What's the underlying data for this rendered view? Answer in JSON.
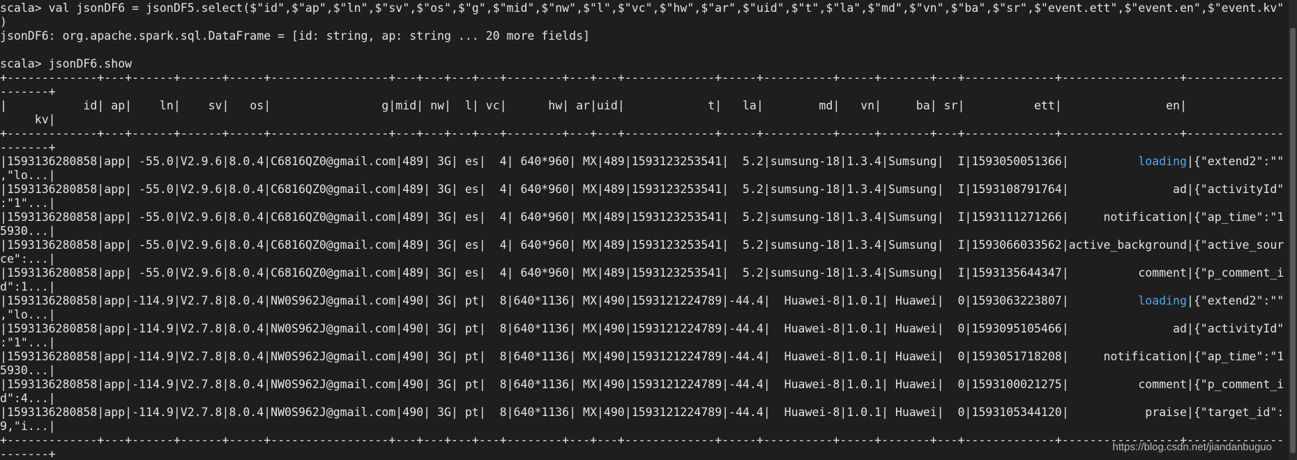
{
  "terminal": {
    "colors": {
      "background": "#1e1e1e",
      "text": "#e4e4e4",
      "highlight": "#4fa9e8"
    },
    "lines": [
      "scala> val jsonDF6 = jsonDF5.select($\"id\",$\"ap\",$\"ln\",$\"sv\",$\"os\",$\"g\",$\"mid\",$\"nw\",$\"l\",$\"vc\",$\"hw\",$\"ar\",$\"uid\",$\"t\",$\"la\",$\"md\",$\"vn\",$\"ba\",$\"sr\",$\"event.ett\",$\"event.en\",$\"event.kv\"",
      ")",
      "jsonDF6: org.apache.spark.sql.DataFrame = [id: string, ap: string ... 20 more fields]",
      "",
      "scala> jsonDF6.show",
      "+-------------+---+------+------+-----+-----------------+---+---+---+---+--------+---+---+-------------+-----+----------+-----+-------+---+-------------+-----------------+--------------",
      "-------+",
      "|           id| ap|    ln|    sv|   os|                g|mid| nw|  l| vc|      hw| ar|uid|            t|   la|        md|   vn|     ba| sr|          ett|               en|",
      "     kv|",
      "+-------------+---+------+------+-----+-----------------+---+---+---+---+--------+---+---+-------------+-----+----------+-----+-------+---+-------------+-----------------+--------------",
      "-------+",
      "|1593136280858|app| -55.0|V2.9.6|8.0.4|C6816QZ0@gmail.com|489| 3G| es|  4| 640*960| MX|489|1593123253541|  5.2|sumsung-18|1.3.4|Sumsung|  I|1593050051366|          loading|{\"extend2\":\"\"",
      ",\"lo...|",
      "|1593136280858|app| -55.0|V2.9.6|8.0.4|C6816QZ0@gmail.com|489| 3G| es|  4| 640*960| MX|489|1593123253541|  5.2|sumsung-18|1.3.4|Sumsung|  I|1593108791764|               ad|{\"activityId\"",
      ":\"1\"...|",
      "|1593136280858|app| -55.0|V2.9.6|8.0.4|C6816QZ0@gmail.com|489| 3G| es|  4| 640*960| MX|489|1593123253541|  5.2|sumsung-18|1.3.4|Sumsung|  I|1593111271266|     notification|{\"ap_time\":\"1",
      "5930...|",
      "|1593136280858|app| -55.0|V2.9.6|8.0.4|C6816QZ0@gmail.com|489| 3G| es|  4| 640*960| MX|489|1593123253541|  5.2|sumsung-18|1.3.4|Sumsung|  I|1593066033562|active_background|{\"active_sour",
      "ce\":...|",
      "|1593136280858|app| -55.0|V2.9.6|8.0.4|C6816QZ0@gmail.com|489| 3G| es|  4| 640*960| MX|489|1593123253541|  5.2|sumsung-18|1.3.4|Sumsung|  I|1593135644347|          comment|{\"p_comment_i",
      "d\":1...|",
      "|1593136280858|app|-114.9|V2.7.8|8.0.4|NW0S962J@gmail.com|490| 3G| pt|  8|640*1136| MX|490|1593121224789|-44.4|  Huawei-8|1.0.1| Huawei|  0|1593063223807|          loading|{\"extend2\":\"\"",
      ",\"lo...|",
      "|1593136280858|app|-114.9|V2.7.8|8.0.4|NW0S962J@gmail.com|490| 3G| pt|  8|640*1136| MX|490|1593121224789|-44.4|  Huawei-8|1.0.1| Huawei|  0|1593095105466|               ad|{\"activityId\"",
      ":\"1\"...|",
      "|1593136280858|app|-114.9|V2.7.8|8.0.4|NW0S962J@gmail.com|490| 3G| pt|  8|640*1136| MX|490|1593121224789|-44.4|  Huawei-8|1.0.1| Huawei|  0|1593051718208|     notification|{\"ap_time\":\"1",
      "5930...|",
      "|1593136280858|app|-114.9|V2.7.8|8.0.4|NW0S962J@gmail.com|490| 3G| pt|  8|640*1136| MX|490|1593121224789|-44.4|  Huawei-8|1.0.1| Huawei|  0|1593100021275|          comment|{\"p_comment_i",
      "d\":4...|",
      "|1593136280858|app|-114.9|V2.7.8|8.0.4|NW0S962J@gmail.com|490| 3G| pt|  8|640*1136| MX|490|1593121224789|-44.4|  Huawei-8|1.0.1| Huawei|  0|1593105344120|           praise|{\"target_id\":",
      "9,\"i...|",
      "+-------------+---+------+------+-----+-----------------+---+---+---+---+--------+---+---+-------------+-----+----------+-----+-------+---+-------------+-----------------+--------------",
      "-------+"
    ],
    "highlights": [
      {
        "line": 11,
        "text": "loading"
      },
      {
        "line": 21,
        "text": "loading"
      }
    ]
  },
  "watermark": "https://blog.csdn.net/jiandanbuguo"
}
